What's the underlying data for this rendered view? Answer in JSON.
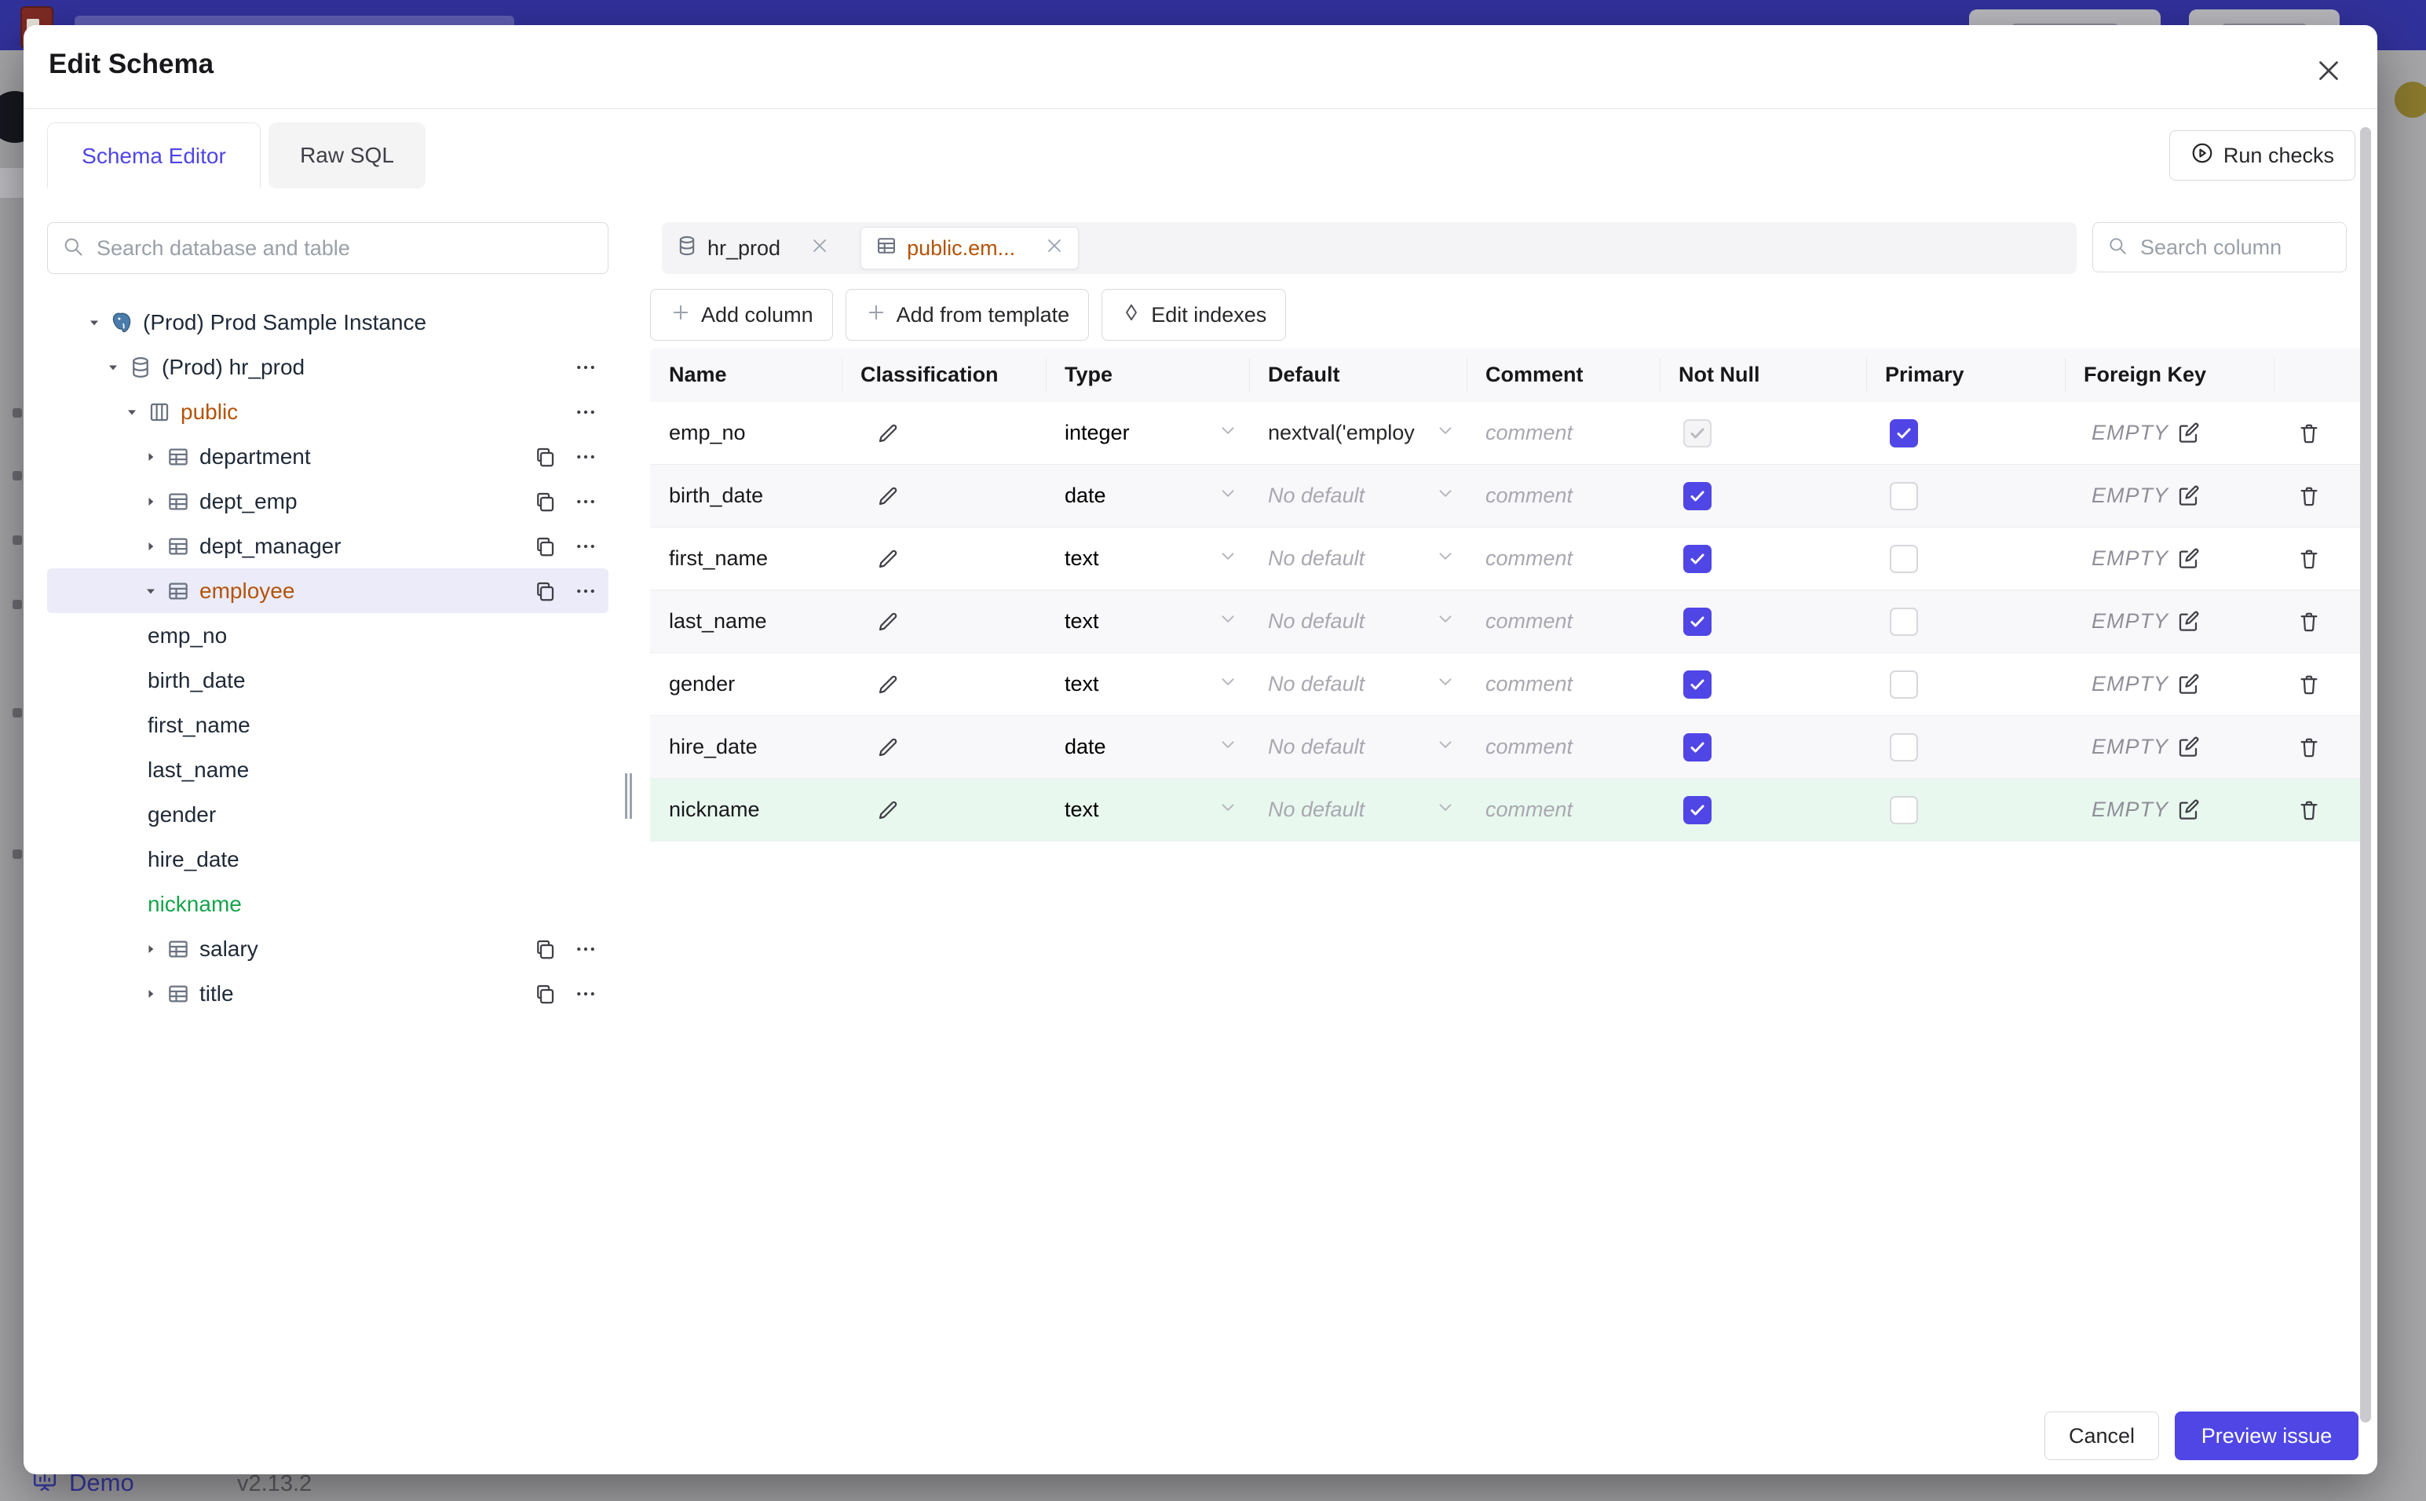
{
  "modal": {
    "title": "Edit Schema",
    "tabs": [
      {
        "label": "Schema Editor",
        "active": true
      },
      {
        "label": "Raw SQL",
        "active": false
      }
    ],
    "run_checks_label": "Run checks",
    "cancel_label": "Cancel",
    "submit_label": "Preview issue"
  },
  "sidebar": {
    "search_placeholder": "Search database and table",
    "tree": [
      {
        "level": 0,
        "caret": "open",
        "icon": "postgres",
        "label": "(Prod) Prod Sample Instance"
      },
      {
        "level": 1,
        "caret": "open",
        "icon": "database",
        "label": "(Prod) hr_prod",
        "menu": true
      },
      {
        "level": 2,
        "caret": "open",
        "icon": "schema",
        "label": "public",
        "label_color": "amber",
        "menu": true
      },
      {
        "level": 3,
        "caret": "closed",
        "icon": "table",
        "label": "department",
        "copy": true,
        "menu": true
      },
      {
        "level": 3,
        "caret": "closed",
        "icon": "table",
        "label": "dept_emp",
        "copy": true,
        "menu": true
      },
      {
        "level": 3,
        "caret": "closed",
        "icon": "table",
        "label": "dept_manager",
        "copy": true,
        "menu": true
      },
      {
        "level": 3,
        "caret": "open",
        "icon": "table",
        "label": "employee",
        "label_color": "amber",
        "copy": true,
        "menu": true,
        "selected": true
      },
      {
        "level": 4,
        "label": "emp_no"
      },
      {
        "level": 4,
        "label": "birth_date"
      },
      {
        "level": 4,
        "label": "first_name"
      },
      {
        "level": 4,
        "label": "last_name"
      },
      {
        "level": 4,
        "label": "gender"
      },
      {
        "level": 4,
        "label": "hire_date"
      },
      {
        "level": 4,
        "label": "nickname",
        "label_color": "green"
      },
      {
        "level": 3,
        "caret": "closed",
        "icon": "table",
        "label": "salary",
        "copy": true,
        "menu": true
      },
      {
        "level": 3,
        "caret": "closed",
        "icon": "table",
        "label": "title",
        "copy": true,
        "menu": true
      }
    ]
  },
  "editor": {
    "chips": [
      {
        "icon": "database",
        "label": "hr_prod"
      },
      {
        "icon": "table",
        "label": "public.em...",
        "active": true
      }
    ],
    "column_search_placeholder": "Search column",
    "toolbar": [
      {
        "icon": "plus",
        "label": "Add column"
      },
      {
        "icon": "plus",
        "label": "Add from template"
      },
      {
        "icon": "diamond",
        "label": "Edit indexes"
      }
    ]
  },
  "schema_table": {
    "columns": [
      "Name",
      "Classification",
      "Type",
      "Default",
      "Comment",
      "Not Null",
      "Primary",
      "Foreign Key",
      ""
    ],
    "rows": [
      {
        "name": "emp_no",
        "type": "integer",
        "default": "nextval('employ",
        "default_set": true,
        "comment_placeholder": "comment",
        "not_null": "checked-disabled",
        "primary": "checked",
        "fk": "EMPTY",
        "bg": "white"
      },
      {
        "name": "birth_date",
        "type": "date",
        "default": "No default",
        "default_set": false,
        "comment_placeholder": "comment",
        "not_null": "checked",
        "primary": "unchecked",
        "fk": "EMPTY",
        "bg": "stripe"
      },
      {
        "name": "first_name",
        "type": "text",
        "default": "No default",
        "default_set": false,
        "comment_placeholder": "comment",
        "not_null": "checked",
        "primary": "unchecked",
        "fk": "EMPTY",
        "bg": "white"
      },
      {
        "name": "last_name",
        "type": "text",
        "default": "No default",
        "default_set": false,
        "comment_placeholder": "comment",
        "not_null": "checked",
        "primary": "unchecked",
        "fk": "EMPTY",
        "bg": "stripe"
      },
      {
        "name": "gender",
        "type": "text",
        "default": "No default",
        "default_set": false,
        "comment_placeholder": "comment",
        "not_null": "checked",
        "primary": "unchecked",
        "fk": "EMPTY",
        "bg": "white"
      },
      {
        "name": "hire_date",
        "type": "date",
        "default": "No default",
        "default_set": false,
        "comment_placeholder": "comment",
        "not_null": "checked",
        "primary": "unchecked",
        "fk": "EMPTY",
        "bg": "stripe"
      },
      {
        "name": "nickname",
        "type": "text",
        "default": "No default",
        "default_set": false,
        "comment_placeholder": "comment",
        "not_null": "checked",
        "primary": "unchecked",
        "fk": "EMPTY",
        "bg": "new"
      }
    ]
  },
  "footer_bar": {
    "demo_label": "Demo",
    "version": "v2.13.2"
  },
  "colors": {
    "primary": "#4f46e5",
    "checkbox": "#5046e5",
    "amber": "#b45309",
    "green": "#16a34a",
    "topbar": "#31319b",
    "new_row_bg": "#e9f8ef",
    "selected_row_bg": "#ebebfa"
  }
}
